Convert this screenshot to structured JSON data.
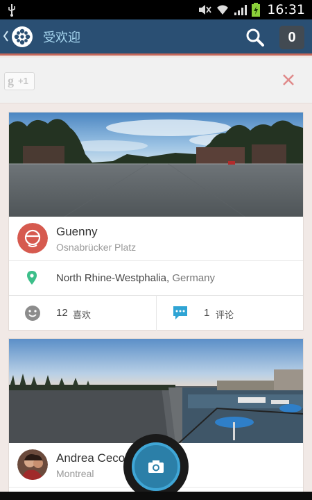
{
  "status_bar": {
    "time": "16:31",
    "icons": [
      "usb-icon",
      "mute-icon",
      "wifi-icon",
      "signal-icon",
      "battery-icon"
    ]
  },
  "header": {
    "title": "受欢迎",
    "notification_count": "0",
    "icons": [
      "back-icon",
      "app-logo-icon",
      "search-icon"
    ]
  },
  "promo": {
    "plus_one_g": "g",
    "plus_one_label": "+1",
    "close_icon": "close-icon"
  },
  "colors": {
    "action_bar": "#2a4f73",
    "accent_line": "#c5675a",
    "title_text": "#a9d9f2",
    "location_pin": "#3cbf8a",
    "comment_icon": "#2fa4d4",
    "fab": "#2b7fa8"
  },
  "posts": [
    {
      "user": "Guenny",
      "place": "Osnabrücker Platz",
      "region": "North Rhine-Westphalia,",
      "country": "Germany",
      "likes_count": "12",
      "likes_label": "喜欢",
      "comments_count": "1",
      "comments_label": "评论"
    },
    {
      "user": "Andrea Ceco",
      "place": "Montreal"
    }
  ]
}
